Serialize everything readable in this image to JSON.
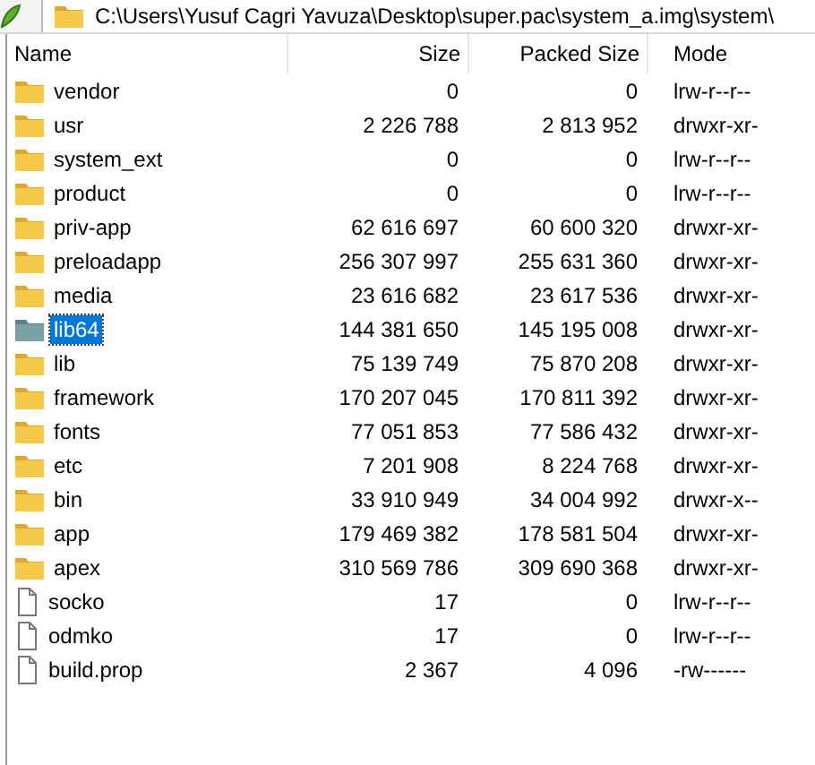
{
  "address_bar": {
    "path": "C:\\Users\\Yusuf Cagri Yavuza\\Desktop\\super.pac\\system_a.img\\system\\"
  },
  "table": {
    "columns": [
      "Name",
      "Size",
      "Packed Size",
      "Mode"
    ],
    "rows": [
      {
        "kind": "folder",
        "name": "vendor",
        "size": "0",
        "packed_size": "0",
        "mode": "lrw-r--r--",
        "selected": false
      },
      {
        "kind": "folder",
        "name": "usr",
        "size": "2 226 788",
        "packed_size": "2 813 952",
        "mode": "drwxr-xr-",
        "selected": false
      },
      {
        "kind": "folder",
        "name": "system_ext",
        "size": "0",
        "packed_size": "0",
        "mode": "lrw-r--r--",
        "selected": false
      },
      {
        "kind": "folder",
        "name": "product",
        "size": "0",
        "packed_size": "0",
        "mode": "lrw-r--r--",
        "selected": false
      },
      {
        "kind": "folder",
        "name": "priv-app",
        "size": "62 616 697",
        "packed_size": "60 600 320",
        "mode": "drwxr-xr-",
        "selected": false
      },
      {
        "kind": "folder",
        "name": "preloadapp",
        "size": "256 307 997",
        "packed_size": "255 631 360",
        "mode": "drwxr-xr-",
        "selected": false
      },
      {
        "kind": "folder",
        "name": "media",
        "size": "23 616 682",
        "packed_size": "23 617 536",
        "mode": "drwxr-xr-",
        "selected": false
      },
      {
        "kind": "folder",
        "name": "lib64",
        "size": "144 381 650",
        "packed_size": "145 195 008",
        "mode": "drwxr-xr-",
        "selected": true
      },
      {
        "kind": "folder",
        "name": "lib",
        "size": "75 139 749",
        "packed_size": "75 870 208",
        "mode": "drwxr-xr-",
        "selected": false
      },
      {
        "kind": "folder",
        "name": "framework",
        "size": "170 207 045",
        "packed_size": "170 811 392",
        "mode": "drwxr-xr-",
        "selected": false
      },
      {
        "kind": "folder",
        "name": "fonts",
        "size": "77 051 853",
        "packed_size": "77 586 432",
        "mode": "drwxr-xr-",
        "selected": false
      },
      {
        "kind": "folder",
        "name": "etc",
        "size": "7 201 908",
        "packed_size": "8 224 768",
        "mode": "drwxr-xr-",
        "selected": false
      },
      {
        "kind": "folder",
        "name": "bin",
        "size": "33 910 949",
        "packed_size": "34 004 992",
        "mode": "drwxr-x--",
        "selected": false
      },
      {
        "kind": "folder",
        "name": "app",
        "size": "179 469 382",
        "packed_size": "178 581 504",
        "mode": "drwxr-xr-",
        "selected": false
      },
      {
        "kind": "folder",
        "name": "apex",
        "size": "310 569 786",
        "packed_size": "309 690 368",
        "mode": "drwxr-xr-",
        "selected": false
      },
      {
        "kind": "file",
        "name": "socko",
        "size": "17",
        "packed_size": "0",
        "mode": "lrw-r--r--",
        "selected": false
      },
      {
        "kind": "file",
        "name": "odmko",
        "size": "17",
        "packed_size": "0",
        "mode": "lrw-r--r--",
        "selected": false
      },
      {
        "kind": "file",
        "name": "build.prop",
        "size": "2 367",
        "packed_size": "4 096",
        "mode": "-rw------",
        "selected": false
      }
    ]
  }
}
